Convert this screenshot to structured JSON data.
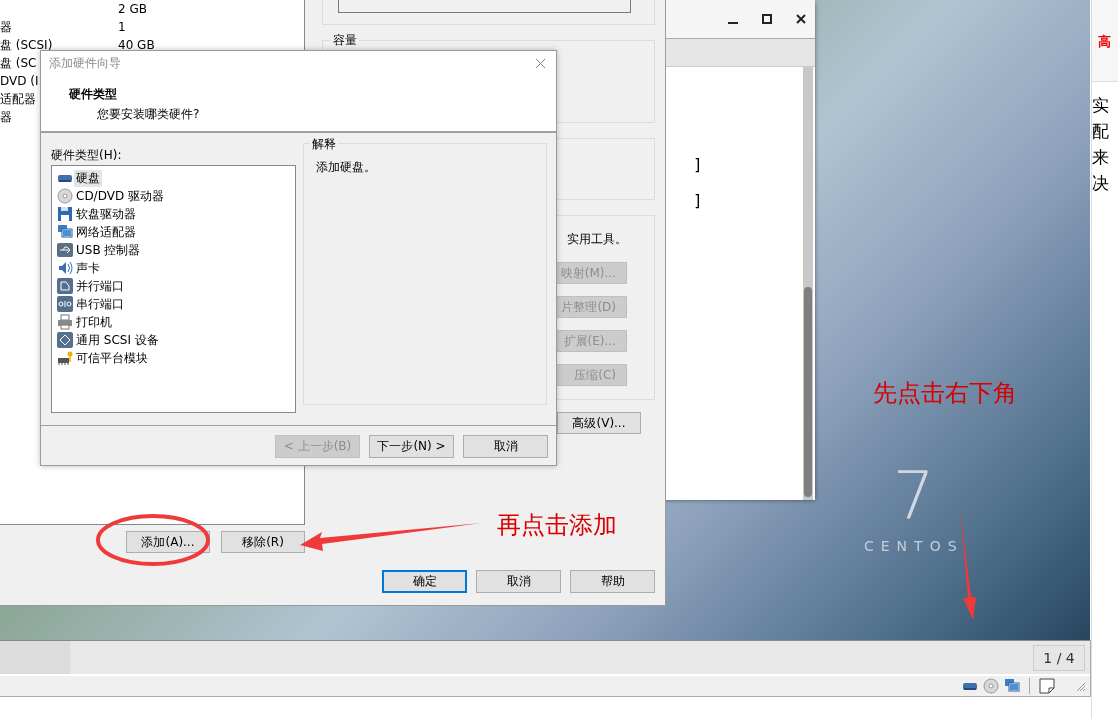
{
  "vm_settings": {
    "device_rows": [
      {
        "value": "2 GB"
      },
      {
        "name": "器",
        "value": "1"
      },
      {
        "name": "盘 (SCSI)",
        "value": "40 GB"
      },
      {
        "name": "盘 (SC"
      },
      {
        "name": "DVD (I"
      },
      {
        "name": "适配器"
      },
      {
        "name": "器"
      }
    ],
    "add_button": "添加(A)...",
    "remove_button": "移除(R)",
    "capacity_label": "容量",
    "utilities_text": "实用工具。",
    "utility_buttons": [
      {
        "label": "映射(M)...",
        "disabled": true
      },
      {
        "label": "片整理(D)",
        "disabled": true
      },
      {
        "label": "扩展(E)...",
        "disabled": true
      },
      {
        "label": "压缩(C)",
        "disabled": true
      }
    ],
    "advanced_button": "高级(V)...",
    "buttons": [
      {
        "label": "确定",
        "default": true
      },
      {
        "label": "取消",
        "default": false
      },
      {
        "label": "帮助",
        "default": false
      }
    ]
  },
  "wizard": {
    "title": "添加硬件向导",
    "heading": "硬件类型",
    "subheading": "您要安装哪类硬件?",
    "list_label": "硬件类型(H):",
    "hardware_types": [
      {
        "label": "硬盘",
        "kind": "disk",
        "selected": true
      },
      {
        "label": "CD/DVD 驱动器",
        "kind": "cdrom",
        "selected": false
      },
      {
        "label": "软盘驱动器",
        "kind": "floppy",
        "selected": false
      },
      {
        "label": "网络适配器",
        "kind": "network",
        "selected": false
      },
      {
        "label": "USB 控制器",
        "kind": "usb",
        "selected": false
      },
      {
        "label": "声卡",
        "kind": "sound",
        "selected": false
      },
      {
        "label": "并行端口",
        "kind": "parallel",
        "selected": false
      },
      {
        "label": "串行端口",
        "kind": "serial",
        "selected": false
      },
      {
        "label": "打印机",
        "kind": "printer",
        "selected": false
      },
      {
        "label": "通用 SCSI 设备",
        "kind": "scsi",
        "selected": false
      },
      {
        "label": "可信平台模块",
        "kind": "tpm",
        "selected": false
      }
    ],
    "explanation_title": "解释",
    "explanation": "添加硬盘。",
    "buttons": [
      {
        "label": "< 上一步(B)",
        "disabled": true
      },
      {
        "label": "下一步(N) >",
        "disabled": false
      },
      {
        "label": "取消",
        "disabled": false
      }
    ]
  },
  "guest_window": {
    "lines": [
      "]",
      "]"
    ]
  },
  "desktop": {
    "logo_number": "7",
    "logo_text": "CENTOS"
  },
  "annotations": [
    {
      "text": "再点击添加"
    },
    {
      "text": "先点击右下角"
    }
  ],
  "status_bar": {
    "page_indicator": "1 / 4"
  },
  "side_page": {
    "title": "高",
    "lines": [
      "实",
      "配",
      "来",
      "决"
    ]
  }
}
